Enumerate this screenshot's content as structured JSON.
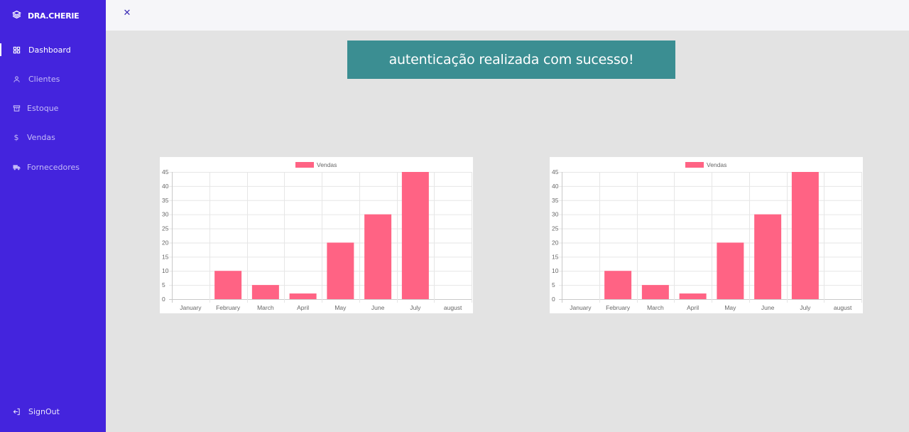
{
  "sidebar": {
    "brand": "DRA.CHERIE",
    "items": [
      {
        "label": "Dashboard",
        "icon": "grid-icon"
      },
      {
        "label": "Clientes",
        "icon": "user-icon"
      },
      {
        "label": "Estoque",
        "icon": "archive-icon"
      },
      {
        "label": "Vendas",
        "icon": "dollar-icon"
      },
      {
        "label": "Fornecedores",
        "icon": "truck-icon"
      }
    ],
    "signout": "SignOut"
  },
  "topbar": {
    "close_icon": "close-icon"
  },
  "toast": {
    "message": "autenticação realizada com sucesso!"
  },
  "colors": {
    "sidebar": "#4424dd",
    "toast": "#3b8e92",
    "bar": "#ff6384"
  },
  "chart_data": [
    {
      "type": "bar",
      "categories": [
        "January",
        "February",
        "March",
        "April",
        "May",
        "June",
        "July",
        "august"
      ],
      "series": [
        {
          "name": "Vendas",
          "values": [
            0,
            10,
            5,
            2,
            20,
            30,
            45,
            0
          ]
        }
      ],
      "ylim": [
        0,
        45
      ],
      "yticks": [
        0,
        5,
        10,
        15,
        20,
        25,
        30,
        35,
        40,
        45
      ],
      "legend": "top",
      "grid": true
    },
    {
      "type": "bar",
      "categories": [
        "January",
        "February",
        "March",
        "April",
        "May",
        "June",
        "July",
        "august"
      ],
      "series": [
        {
          "name": "Vendas",
          "values": [
            0,
            10,
            5,
            2,
            20,
            30,
            45,
            0
          ]
        }
      ],
      "ylim": [
        0,
        45
      ],
      "yticks": [
        0,
        5,
        10,
        15,
        20,
        25,
        30,
        35,
        40,
        45
      ],
      "legend": "top",
      "grid": true
    }
  ]
}
